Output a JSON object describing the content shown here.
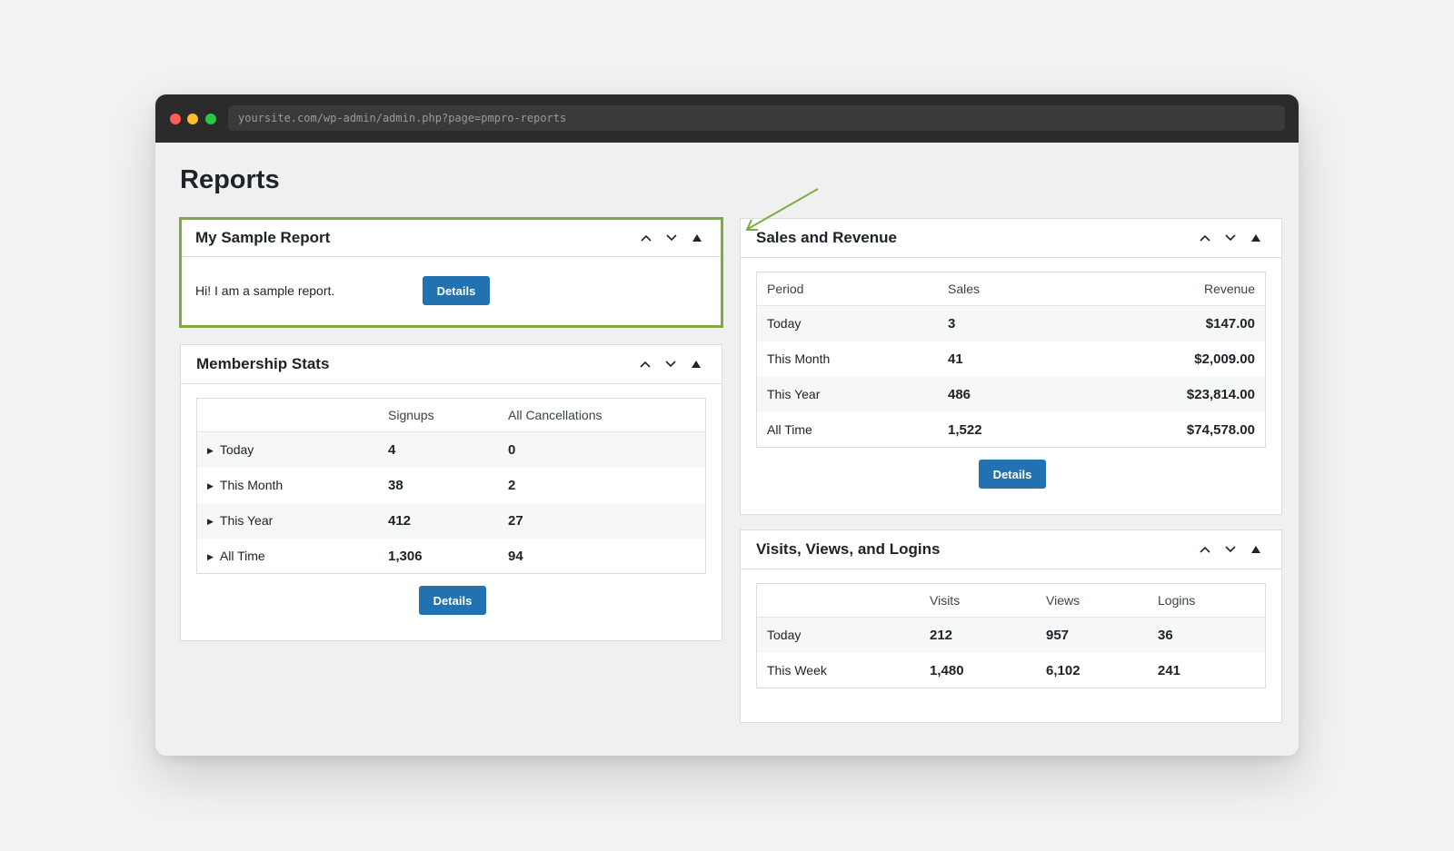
{
  "browser": {
    "url": "yoursite.com/wp-admin/admin.php?page=pmpro-reports"
  },
  "page": {
    "title": "Reports"
  },
  "colors": {
    "accent_button": "#2271b1",
    "highlight_border": "#7cab42",
    "annotation_arrow": "#7cab42"
  },
  "sample_report": {
    "title": "My Sample Report",
    "text": "Hi! I am a sample report.",
    "button": "Details"
  },
  "membership": {
    "title": "Membership Stats",
    "headers": [
      "",
      "Signups",
      "All Cancellations"
    ],
    "rows": [
      {
        "label": "Today",
        "signups": "4",
        "cancellations": "0"
      },
      {
        "label": "This Month",
        "signups": "38",
        "cancellations": "2"
      },
      {
        "label": "This Year",
        "signups": "412",
        "cancellations": "27"
      },
      {
        "label": "All Time",
        "signups": "1,306",
        "cancellations": "94"
      }
    ],
    "button": "Details"
  },
  "sales": {
    "title": "Sales and Revenue",
    "headers": [
      "Period",
      "Sales",
      "Revenue"
    ],
    "rows": [
      {
        "period": "Today",
        "sales": "3",
        "revenue": "$147.00"
      },
      {
        "period": "This Month",
        "sales": "41",
        "revenue": "$2,009.00"
      },
      {
        "period": "This Year",
        "sales": "486",
        "revenue": "$23,814.00"
      },
      {
        "period": "All Time",
        "sales": "1,522",
        "revenue": "$74,578.00"
      }
    ],
    "button": "Details"
  },
  "visits": {
    "title": "Visits, Views, and Logins",
    "headers": [
      "",
      "Visits",
      "Views",
      "Logins"
    ],
    "rows": [
      {
        "period": "Today",
        "visits": "212",
        "views": "957",
        "logins": "36"
      },
      {
        "period": "This Week",
        "visits": "1,480",
        "views": "6,102",
        "logins": "241"
      }
    ]
  }
}
